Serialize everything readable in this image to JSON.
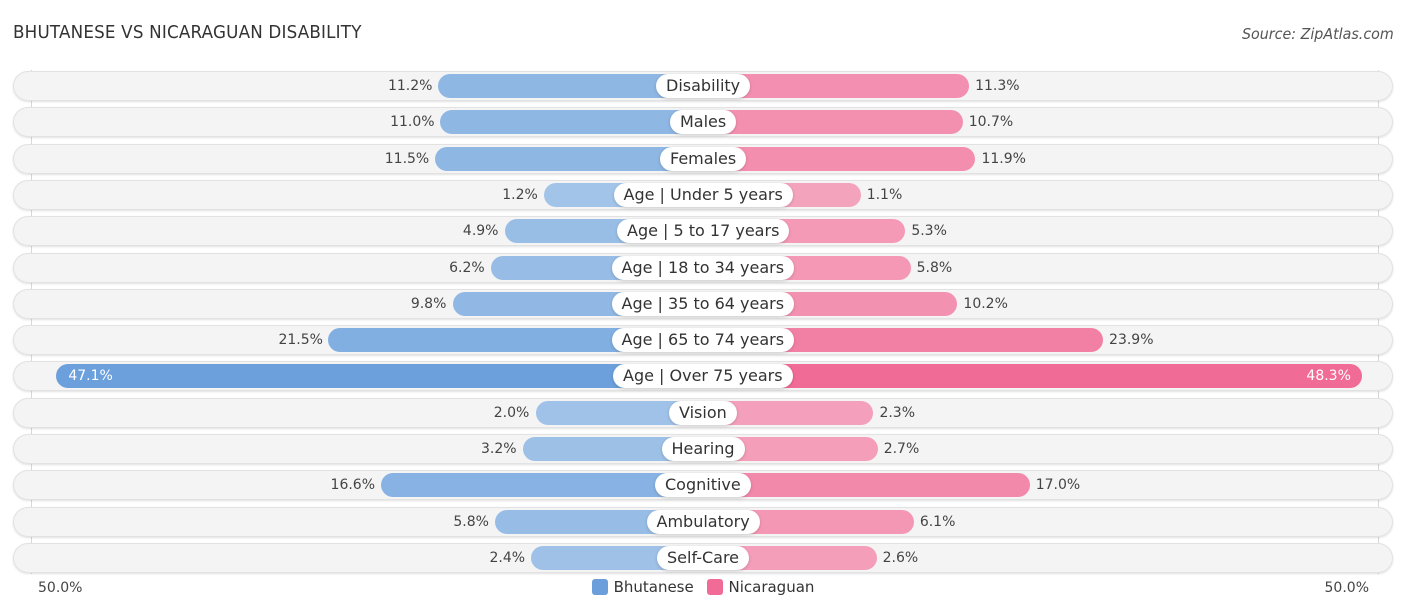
{
  "header": {
    "title": "BHUTANESE VS NICARAGUAN DISABILITY",
    "source": "Source: ZipAtlas.com"
  },
  "axis": {
    "left_label": "50.0%",
    "right_label": "50.0%"
  },
  "legend": [
    {
      "name": "Bhutanese",
      "color": "#6a9fdc"
    },
    {
      "name": "Nicaraguan",
      "color": "#f06b96"
    }
  ],
  "colors": {
    "left_strong": "#6a9fdc",
    "left_light": "#a9c8ea",
    "right_strong": "#f06b96",
    "right_light": "#f5a9c2",
    "track": "#f4f4f4"
  },
  "chart_data": {
    "type": "bar",
    "orientation": "horizontal-diverging",
    "title": "BHUTANESE VS NICARAGUAN DISABILITY",
    "xlabel": "",
    "ylabel": "",
    "xlim": [
      -50,
      50
    ],
    "legend_position": "bottom-center",
    "categories": [
      "Disability",
      "Males",
      "Females",
      "Age | Under 5 years",
      "Age | 5 to 17 years",
      "Age | 18 to 34 years",
      "Age | 35 to 64 years",
      "Age | 65 to 74 years",
      "Age | Over 75 years",
      "Vision",
      "Hearing",
      "Cognitive",
      "Ambulatory",
      "Self-Care"
    ],
    "series": [
      {
        "name": "Bhutanese",
        "side": "left",
        "values": [
          11.2,
          11.0,
          11.5,
          1.2,
          4.9,
          6.2,
          9.8,
          21.5,
          47.1,
          2.0,
          3.2,
          16.6,
          5.8,
          2.4
        ],
        "labels": [
          "11.2%",
          "11.0%",
          "11.5%",
          "1.2%",
          "4.9%",
          "6.2%",
          "9.8%",
          "21.5%",
          "47.1%",
          "2.0%",
          "3.2%",
          "16.6%",
          "5.8%",
          "2.4%"
        ]
      },
      {
        "name": "Nicaraguan",
        "side": "right",
        "values": [
          11.3,
          10.7,
          11.9,
          1.1,
          5.3,
          5.8,
          10.2,
          23.9,
          48.3,
          2.3,
          2.7,
          17.0,
          6.1,
          2.6
        ],
        "labels": [
          "11.3%",
          "10.7%",
          "11.9%",
          "1.1%",
          "5.3%",
          "5.8%",
          "10.2%",
          "23.9%",
          "48.3%",
          "2.3%",
          "2.7%",
          "17.0%",
          "6.1%",
          "2.6%"
        ]
      }
    ]
  }
}
